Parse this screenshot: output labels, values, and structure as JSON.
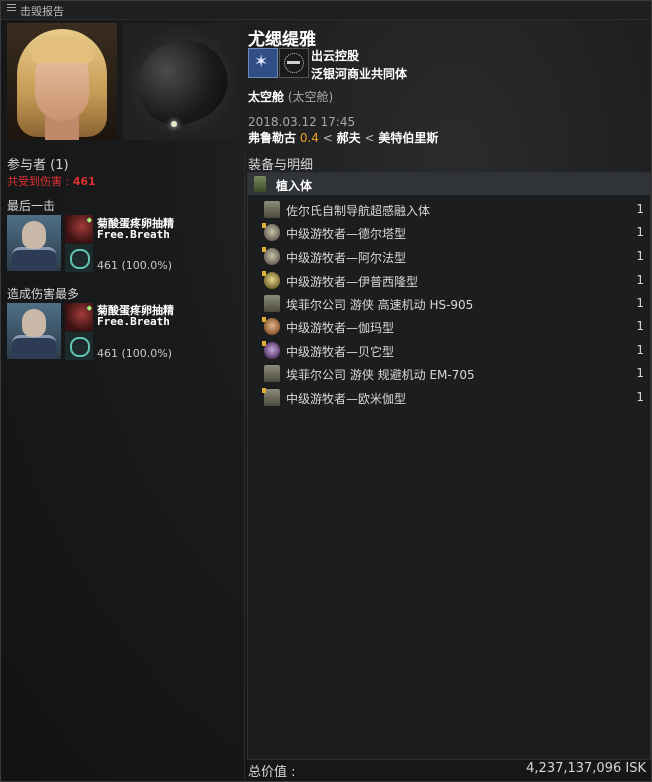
{
  "window": {
    "title": "击毁报告"
  },
  "victim": {
    "name": "尤缌缇雅",
    "corporation": "出云控股",
    "alliance": "泛银河商业共同体",
    "ship_name": "太空舱",
    "ship_type": "(太空舱)",
    "datetime": "2018.03.12 17:45",
    "location": {
      "system": "弗鲁勒古",
      "security": "0.4",
      "constellation": "郝夫",
      "region": "美特伯里斯",
      "separator": "<"
    }
  },
  "participants": {
    "title": "参与者 (1)",
    "damage_label": "共受到伤害 :",
    "damage_value": "461",
    "final_blow": {
      "heading": "最后一击",
      "pilot": "菊酸蛋疼卵抽精",
      "corp": "Free.Breath",
      "damage": "461 (100.0%)"
    },
    "top_damage": {
      "heading": "造成伤害最多",
      "pilot": "菊酸蛋疼卵抽精",
      "corp": "Free.Breath",
      "damage": "461 (100.0%)"
    }
  },
  "items": {
    "title": "装备与明细",
    "group_label": "植入体",
    "rows": [
      {
        "name": "佐尔氏自制导航超感融入体",
        "qty": "1",
        "icon": "implant-icon"
      },
      {
        "name": "中级游牧者—德尔塔型",
        "qty": "1",
        "icon": "implant-face-icon"
      },
      {
        "name": "中级游牧者—阿尔法型",
        "qty": "1",
        "icon": "implant-face-icon"
      },
      {
        "name": "中级游牧者—伊普西隆型",
        "qty": "1",
        "icon": "implant-face-icon"
      },
      {
        "name": "埃菲尔公司 游侠 高速机动 HS-905",
        "qty": "1",
        "icon": "implant-icon"
      },
      {
        "name": "中级游牧者—伽玛型",
        "qty": "1",
        "icon": "implant-face-icon"
      },
      {
        "name": "中级游牧者—贝它型",
        "qty": "1",
        "icon": "implant-face-icon"
      },
      {
        "name": "埃菲尔公司 游侠 规避机动 EM-705",
        "qty": "1",
        "icon": "implant-icon"
      },
      {
        "name": "中级游牧者—欧米伽型",
        "qty": "1",
        "icon": "implant-icon"
      }
    ]
  },
  "total": {
    "label": "总价值 :",
    "value": "4,237,137,096 ISK"
  },
  "colors": {
    "security": "#f0a020",
    "damage_red": "#e03030",
    "background": "#141516"
  }
}
